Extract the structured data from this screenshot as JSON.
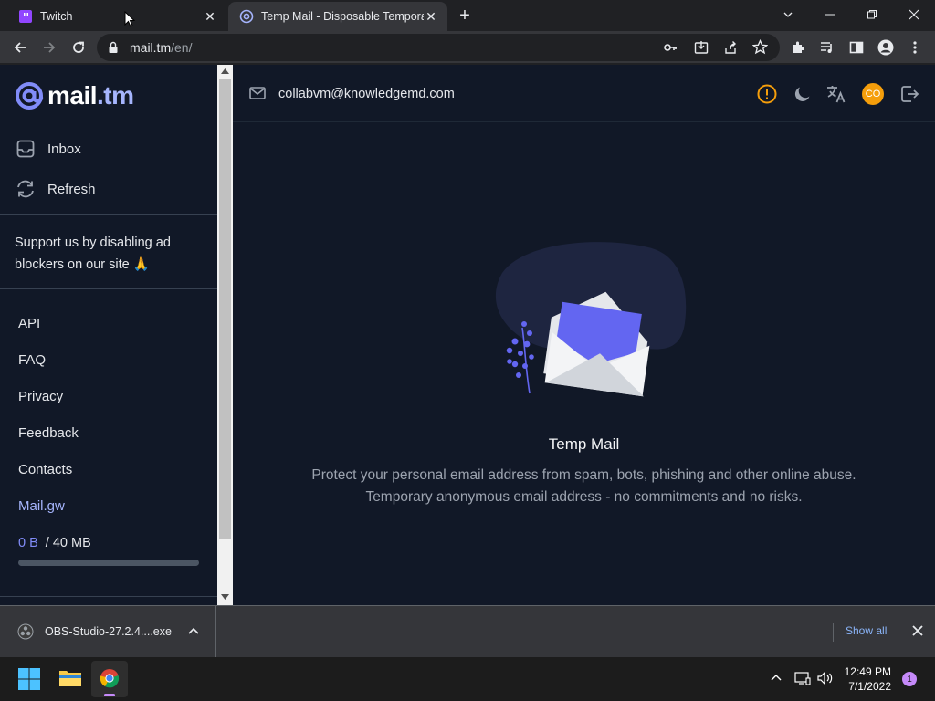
{
  "browser": {
    "tabs": [
      {
        "title": "Twitch",
        "active": false
      },
      {
        "title": "Temp Mail - Disposable Temporary",
        "active": true
      }
    ],
    "address": {
      "host": "mail.tm",
      "path": "/en/"
    }
  },
  "sidebar": {
    "logo": {
      "name": "mail",
      "tld": ".tm"
    },
    "nav": [
      {
        "label": "Inbox",
        "icon": "inbox-icon"
      },
      {
        "label": "Refresh",
        "icon": "refresh-icon"
      }
    ],
    "support_text": "Support us by disabling ad blockers on our site 🙏",
    "links": [
      "API",
      "FAQ",
      "Privacy",
      "Feedback",
      "Contacts",
      "Mail.gw"
    ],
    "storage": {
      "used": "0 B",
      "total": "/ 40 MB",
      "fraction": 0
    }
  },
  "main": {
    "email": "collabvm@knowledgemd.com",
    "avatar_initials": "CO",
    "hero_title": "Temp Mail",
    "hero_line1": "Protect your personal email address from spam, bots, phishing and other online abuse.",
    "hero_line2": "Temporary anonymous email address - no commitments and no risks."
  },
  "downloads": {
    "file": "OBS-Studio-27.2.4....exe",
    "show_all": "Show all"
  },
  "taskbar": {
    "time": "12:49 PM",
    "date": "7/1/2022",
    "notifications": "1"
  },
  "colors": {
    "page_bg": "#111827",
    "accent": "#6366f1",
    "accent_light": "#a5b4fc",
    "avatar": "#f59e0b"
  }
}
